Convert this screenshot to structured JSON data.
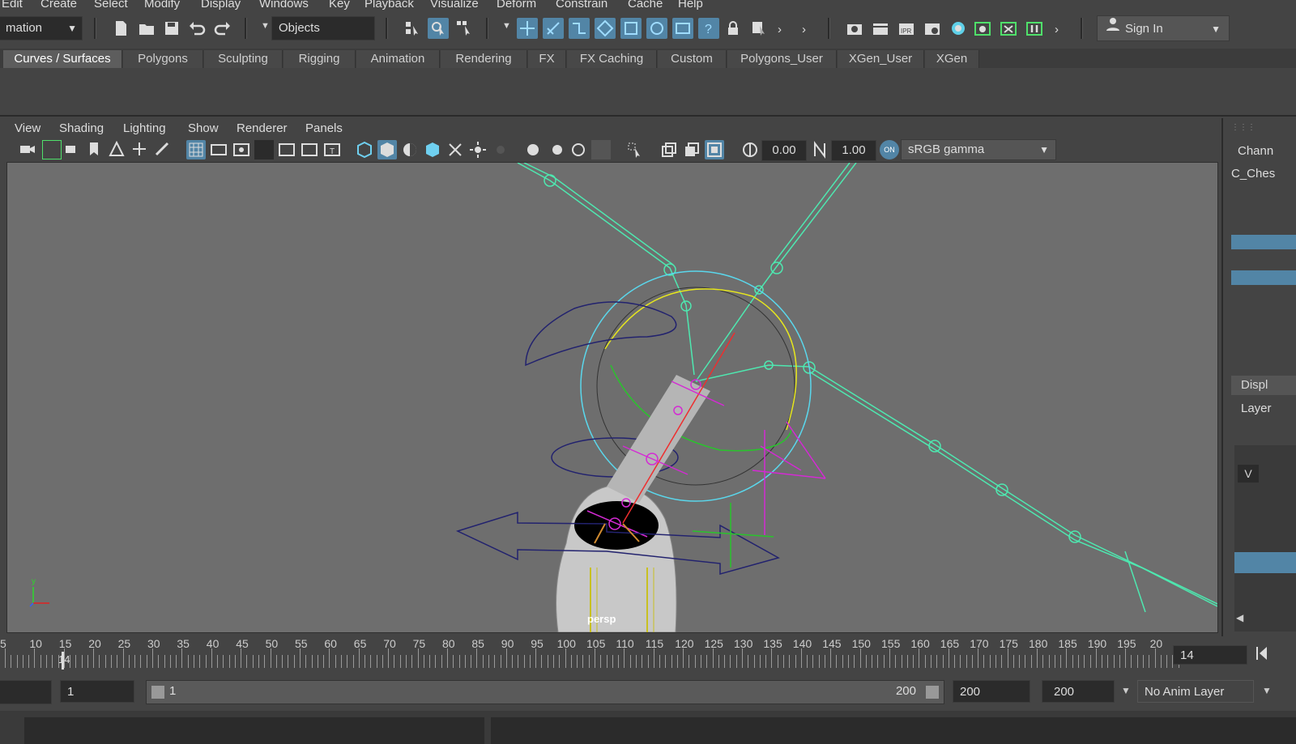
{
  "menubar": {
    "items": [
      "Edit",
      "Create",
      "Select",
      "Modify",
      "Display",
      "Windows",
      "Key",
      "Playback",
      "Visualize",
      "Deform",
      "Constrain",
      "Cache",
      "Help"
    ]
  },
  "statusline": {
    "mode_menu": "mation",
    "selection_mode": "Objects",
    "sign_in": "Sign In"
  },
  "shelf": {
    "tabs": [
      "Curves / Surfaces",
      "Polygons",
      "Sculpting",
      "Rigging",
      "Animation",
      "Rendering",
      "FX",
      "FX Caching",
      "Custom",
      "Polygons_User",
      "XGen_User",
      "XGen"
    ],
    "active_tab": "Curves / Surfaces"
  },
  "panel": {
    "menus": [
      "View",
      "Shading",
      "Lighting",
      "Show",
      "Renderer",
      "Panels"
    ],
    "exposure": "0.00",
    "gamma": "1.00",
    "color_space": "sRGB gamma",
    "camera_label": "persp"
  },
  "channel_box": {
    "title": "Chann",
    "object": "C_Ches",
    "display_tab": "Displ",
    "layers_label": "Layer",
    "visibility": "V"
  },
  "timeline": {
    "ticks": [
      "5",
      "10",
      "15",
      "20",
      "25",
      "30",
      "35",
      "40",
      "45",
      "50",
      "55",
      "60",
      "65",
      "70",
      "75",
      "80",
      "85",
      "90",
      "95",
      "100",
      "105",
      "110",
      "115",
      "120",
      "125",
      "130",
      "135",
      "140",
      "145",
      "150",
      "155",
      "160",
      "165",
      "170",
      "175",
      "180",
      "185",
      "190",
      "195",
      "20"
    ],
    "current_frame_marker": "14",
    "current_frame_field": "14"
  },
  "range": {
    "start": "1",
    "slider_start": "1",
    "slider_end": "200",
    "end": "200",
    "max": "200",
    "anim_layer": "No Anim Layer"
  },
  "colors": {
    "accent": "#5285a6",
    "joint": "#4ee8b0",
    "viewport": "#6e6e6e"
  }
}
